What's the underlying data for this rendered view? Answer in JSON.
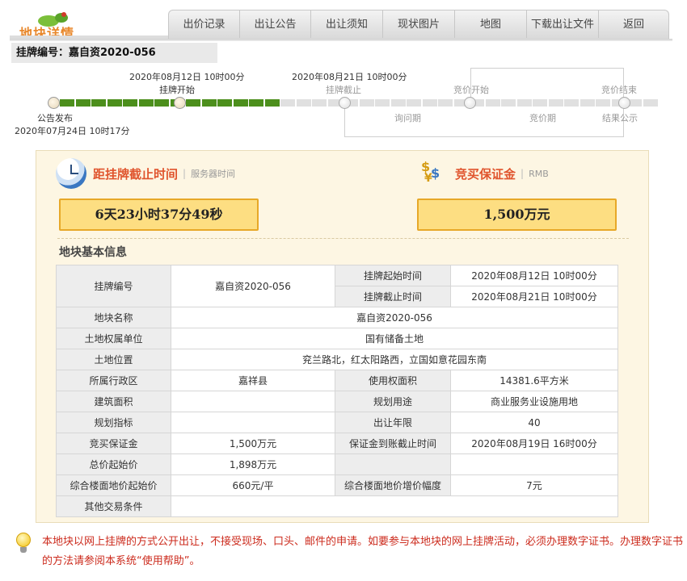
{
  "header": {
    "logo_title": "地块详情",
    "tabs": [
      "出价记录",
      "出让公告",
      "出让须知",
      "现状图片",
      "地图",
      "下载出让文件",
      "返回"
    ]
  },
  "listing": {
    "label": "挂牌编号：",
    "code": "嘉自资2020-056"
  },
  "timeline": {
    "listing_start_date": "2020年08月12日 10时00分",
    "listing_start_label": "挂牌开始",
    "listing_end_date": "2020年08月21日 10时00分",
    "listing_end_label": "挂牌截止",
    "bidding_start_label": "竞价开始",
    "bidding_end_label": "竞价结束",
    "announce_label": "公告发布",
    "announce_date": "2020年07月24日 10时17分",
    "inquiry_label": "询问期",
    "bidding_label": "竞价期",
    "result_label": "结果公示",
    "progress_green_segments": 14,
    "progress_total_segments": 38
  },
  "countdown": {
    "title": "距挂牌截止时间",
    "sub": "服务器时间",
    "value": "6天23小时37分49秒"
  },
  "deposit": {
    "title": "竞买保证金",
    "sub": "RMB",
    "value": "1,500万元"
  },
  "info": {
    "section_title": "地块基本信息",
    "listing_code_label": "挂牌编号",
    "listing_code": "嘉自资2020-056",
    "start_time_label": "挂牌起始时间",
    "start_time": "2020年08月12日 10时00分",
    "end_time_label": "挂牌截止时间",
    "end_time": "2020年08月21日 10时00分",
    "parcel_name_label": "地块名称",
    "parcel_name": "嘉自资2020-056",
    "owner_label": "土地权属单位",
    "owner": "国有储备土地",
    "location_label": "土地位置",
    "location": "兖兰路北，红太阳路西，立国如意花园东南",
    "district_label": "所属行政区",
    "district": "嘉祥县",
    "area_label": "使用权面积",
    "area": "14381.6平方米",
    "building_area_label": "建筑面积",
    "building_area": "",
    "usage_label": "规划用途",
    "usage": "商业服务业设施用地",
    "planning_label": "规划指标",
    "planning": "",
    "years_label": "出让年限",
    "years": "40",
    "deposit_label": "竞买保证金",
    "deposit": "1,500万元",
    "deposit_deadline_label": "保证金到账截止时间",
    "deposit_deadline": "2020年08月19日 16时00分",
    "start_price_label": "总价起始价",
    "start_price": "1,898万元",
    "floor_price_label": "综合楼面地价起始价",
    "floor_price": "660元/平",
    "increment_label": "综合楼面地价增价幅度",
    "increment": "7元",
    "other_label": "其他交易条件",
    "other": ""
  },
  "notice": {
    "text": "本地块以网上挂牌的方式公开出让，不接受现场、口头、邮件的申请。如要参与本地块的网上挂牌活动，必须办理数字证书。办理数字证书的方法请参阅本系统“使用帮助”。"
  }
}
